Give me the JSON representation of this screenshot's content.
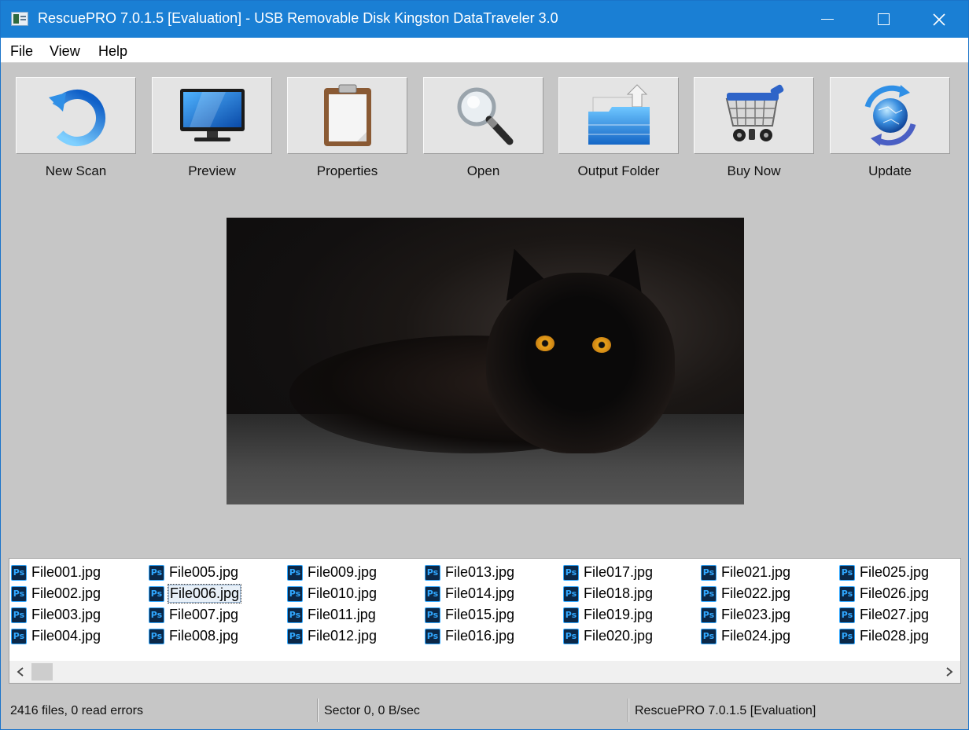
{
  "window": {
    "title": "RescuePRO 7.0.1.5 [Evaluation] - USB Removable Disk Kingston DataTraveler 3.0"
  },
  "menu": [
    "File",
    "View",
    "Help"
  ],
  "toolbar": [
    {
      "label": "New Scan",
      "icon": "refresh-icon"
    },
    {
      "label": "Preview",
      "icon": "monitor-icon"
    },
    {
      "label": "Properties",
      "icon": "clipboard-icon"
    },
    {
      "label": "Open",
      "icon": "magnifier-icon"
    },
    {
      "label": "Output Folder",
      "icon": "folder-upload-icon"
    },
    {
      "label": "Buy Now",
      "icon": "shopping-cart-icon"
    },
    {
      "label": "Update",
      "icon": "globe-sync-icon"
    }
  ],
  "files": [
    "File001.jpg",
    "File002.jpg",
    "File003.jpg",
    "File004.jpg",
    "File005.jpg",
    "File006.jpg",
    "File007.jpg",
    "File008.jpg",
    "File009.jpg",
    "File010.jpg",
    "File011.jpg",
    "File012.jpg",
    "File013.jpg",
    "File014.jpg",
    "File015.jpg",
    "File016.jpg",
    "File017.jpg",
    "File018.jpg",
    "File019.jpg",
    "File020.jpg",
    "File021.jpg",
    "File022.jpg",
    "File023.jpg",
    "File024.jpg",
    "File025.jpg",
    "File026.jpg",
    "File027.jpg",
    "File028.jpg"
  ],
  "selected_file": "File006.jpg",
  "file_icon_text": "Ps",
  "status": {
    "files": "2416 files, 0 read errors",
    "sector": "Sector 0, 0 B/sec",
    "version": "RescuePRO 7.0.1.5 [Evaluation]"
  }
}
